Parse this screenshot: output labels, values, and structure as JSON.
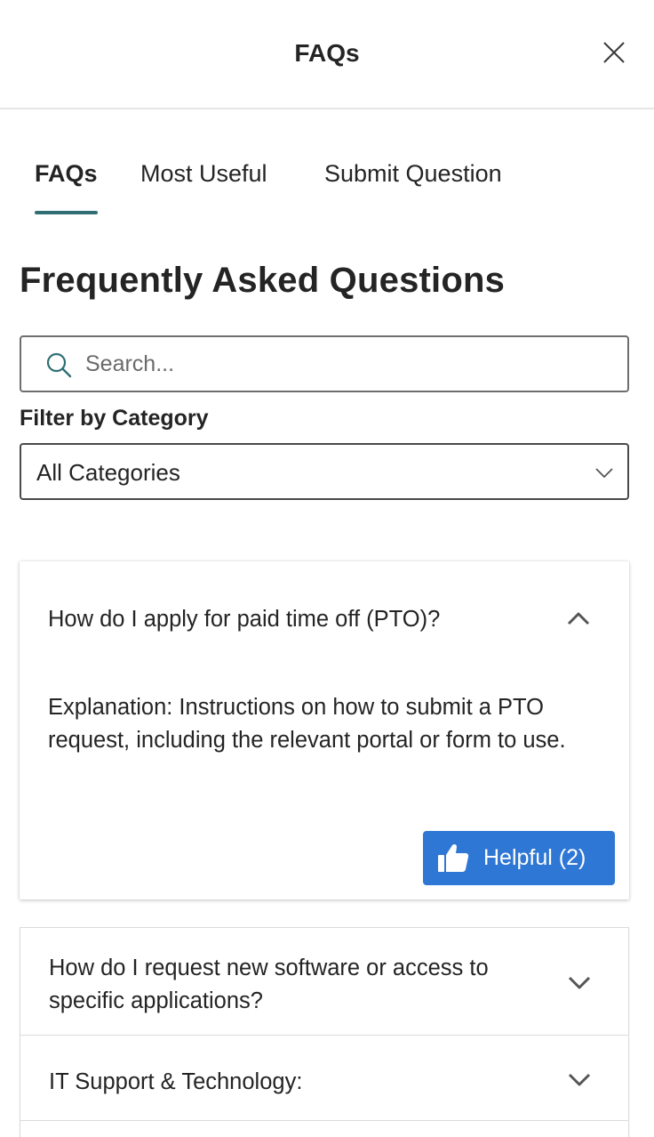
{
  "header": {
    "title": "FAQs",
    "close_icon": "close-icon"
  },
  "tabs": [
    {
      "label": "FAQs",
      "active": true
    },
    {
      "label": "Most Useful",
      "active": false
    },
    {
      "label": "Submit Question",
      "active": false
    }
  ],
  "page_title": "Frequently Asked Questions",
  "search": {
    "placeholder": "Search...",
    "value": "",
    "icon": "search-icon"
  },
  "filter": {
    "label": "Filter by Category",
    "selected": "All Categories",
    "icon": "chevron-down-icon"
  },
  "faqs": [
    {
      "question": "How do I apply for paid time off (PTO)?",
      "expanded": true,
      "answer": "Explanation: Instructions on how to submit a PTO request, including the relevant portal or form to use.",
      "helpful_label": "Helpful (2)",
      "helpful_icon": "thumbs-up-icon"
    },
    {
      "question": "How do I request new software or access to specific applications?",
      "expanded": false
    },
    {
      "question": "IT Support & Technology:",
      "expanded": false
    }
  ],
  "colors": {
    "accent": "#2f6f73",
    "button": "#2f77d4",
    "text": "#242424",
    "divider": "#e6e6e6"
  }
}
